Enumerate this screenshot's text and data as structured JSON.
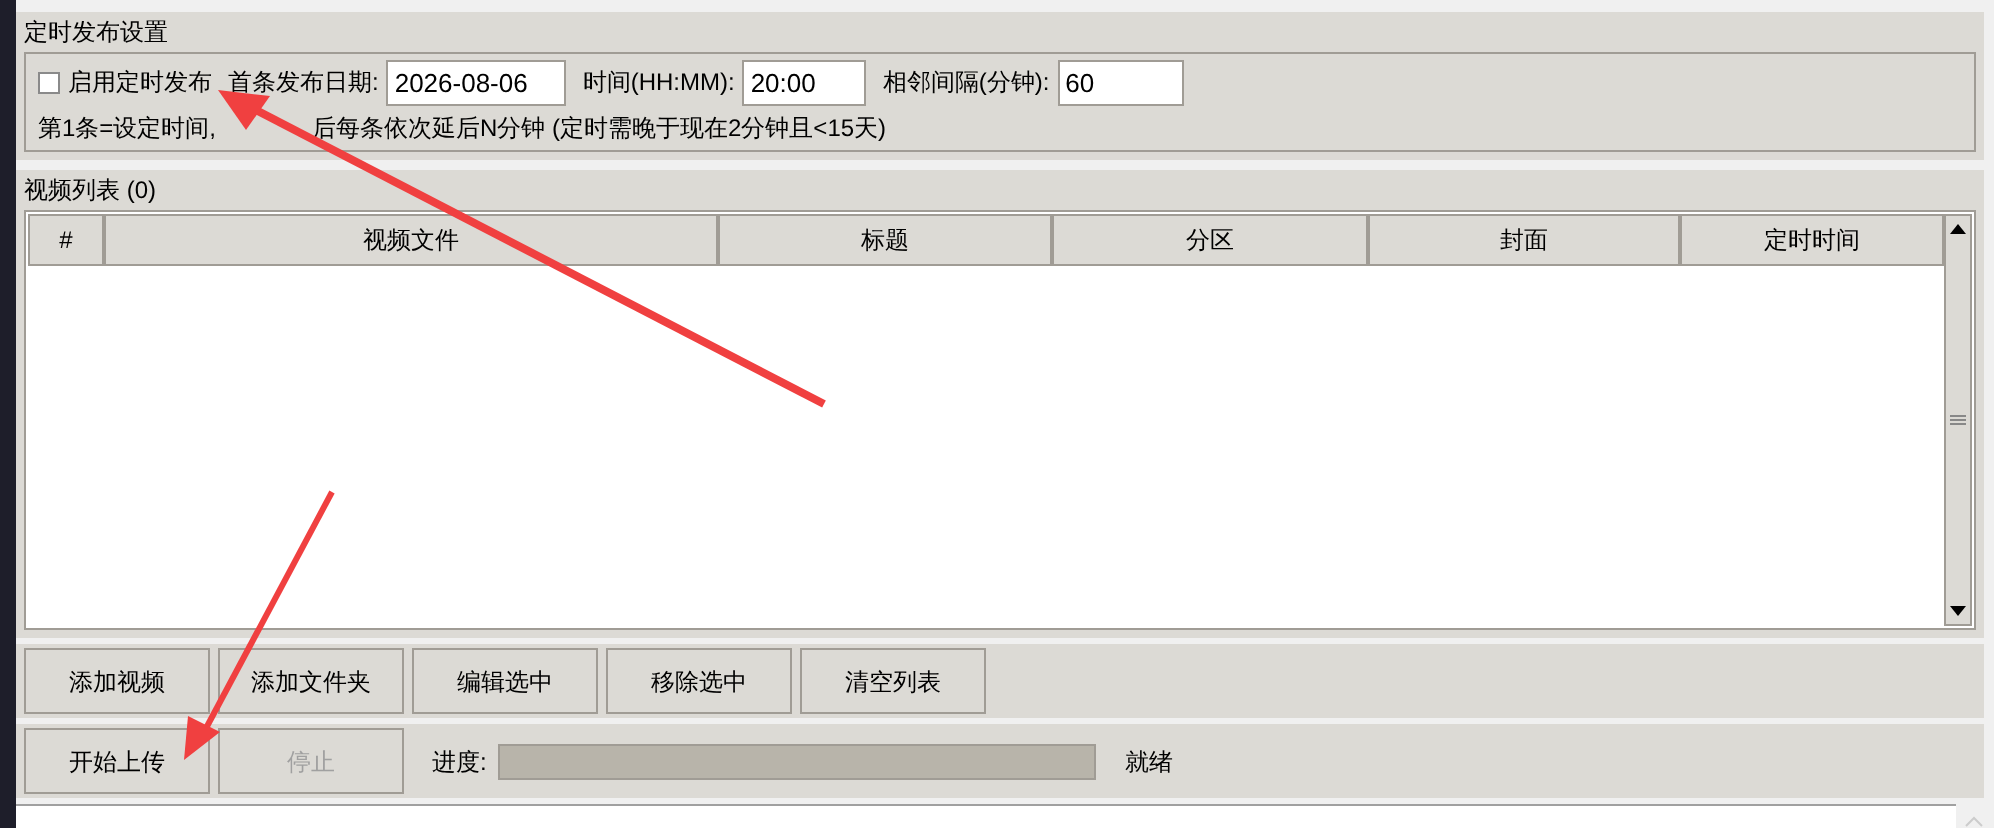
{
  "schedule": {
    "title": "定时发布设置",
    "enable": {
      "label": "启用定时发布",
      "checked": false
    },
    "fields": [
      {
        "label": "首条发布日期:",
        "value": "2026-08-06"
      },
      {
        "label": "时间(HH:MM):",
        "value": "20:00"
      },
      {
        "label": "相邻间隔(分钟):",
        "value": "60"
      }
    ],
    "hint": [
      "第1条=设定时间,",
      "后每条依次延后N分钟 (定时需晚于现在2分钟且<15天)"
    ]
  },
  "video_list": {
    "title": "视频列表 (0)",
    "columns": [
      "#",
      "视频文件",
      "标题",
      "分区",
      "封面",
      "定时时间"
    ]
  },
  "list_buttons": [
    {
      "label": "添加视频",
      "disabled": false
    },
    {
      "label": "添加文件夹",
      "disabled": false
    },
    {
      "label": "编辑选中",
      "disabled": false
    },
    {
      "label": "移除选中",
      "disabled": false
    },
    {
      "label": "清空列表",
      "disabled": false
    }
  ],
  "upload_buttons": [
    {
      "label": "开始上传",
      "disabled": false
    },
    {
      "label": "停止",
      "disabled": true
    }
  ],
  "progress": {
    "label": "进度:",
    "level": 0,
    "status": "就绪"
  }
}
